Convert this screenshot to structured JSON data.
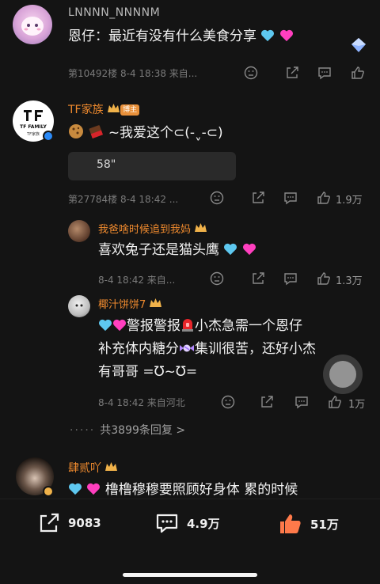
{
  "comments": [
    {
      "username": "LNNNN_NNNNM",
      "text": "恩仔：最近有没有什么美食分享",
      "meta": "第10492楼 8-4 18:38 来自..."
    },
    {
      "username": "TF家族",
      "badge": "博主",
      "avatar_text": "TF FAMILY",
      "avatar_sub": "TF家族",
      "text": "~我爱这个⊂(-ˬ-⊂)",
      "quote": "58\"",
      "meta": "第27784楼 8-4 18:42 ...",
      "likes": "1.9万"
    }
  ],
  "replies": [
    {
      "username": "我爸啥时候追到我妈",
      "text": "喜欢兔子还是猫头鹰",
      "meta": "8-4 18:42 来自...",
      "likes": "1.3万"
    },
    {
      "username": "椰汁饼饼7",
      "text_line1": "警报警报",
      "text_line1b": "小杰急需一个恩仔",
      "text_line2": "补充体内糖分",
      "text_line2b": "集训很苦，还好小杰",
      "text_line3": "有哥哥 =Ʊ~Ʊ=",
      "meta": "8-4 18:42 来自河北",
      "likes": "1万"
    }
  ],
  "more_replies": "共3899条回复 >",
  "more_dots": "·····",
  "last_comment": {
    "username": "肆贰吖",
    "text": "橹橹穆穆要照顾好身体 累的时候"
  },
  "bottom_bar": {
    "share_count": "9083",
    "comment_count": "4.9万",
    "like_count": "51万"
  },
  "colors": {
    "background": "#141414",
    "username_orange": "#ef8a2e",
    "heart_blue": "#5ec8f0",
    "heart_pink": "#ff3fbf",
    "like_active": "#ff7a4a"
  }
}
